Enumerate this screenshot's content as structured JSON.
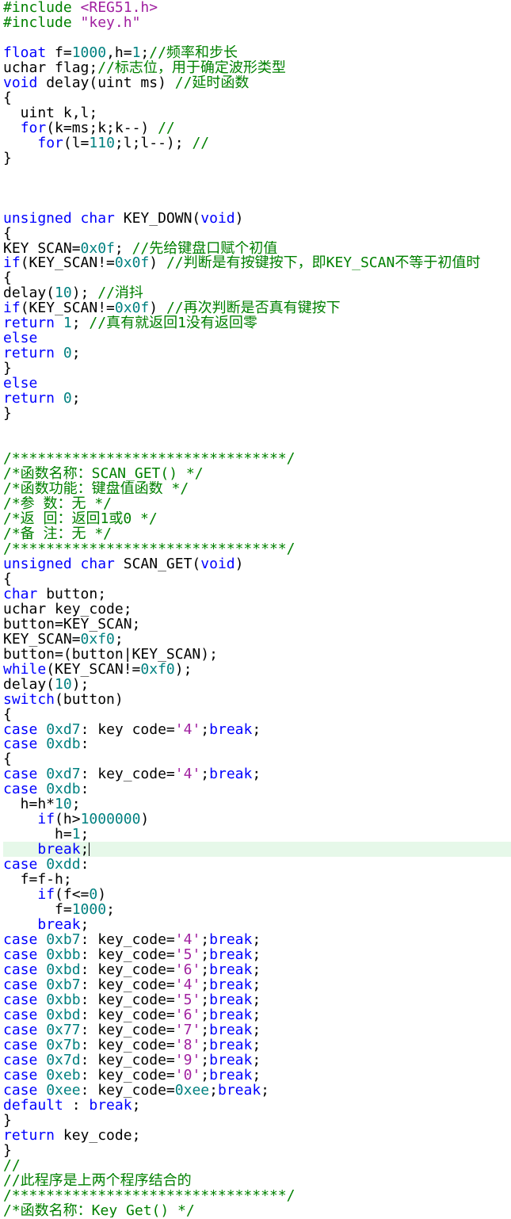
{
  "theme": {
    "background": "#FFFFFF",
    "text": "#000000",
    "keyword": "#0000FF",
    "number": "#008080",
    "string": "#A020A0",
    "char": "#A020A0",
    "comment": "#008000",
    "preproc": "#008000",
    "current_line": "#E6F8E9",
    "cursor": "#000000"
  },
  "editor": {
    "current_line": 57,
    "lines": [
      [
        [
          "preproc",
          "#include"
        ],
        [
          "text",
          " "
        ],
        [
          "string",
          "<REG51.h>"
        ]
      ],
      [
        [
          "preproc",
          "#include"
        ],
        [
          "text",
          " "
        ],
        [
          "string",
          "\"key.h\""
        ]
      ],
      [],
      [
        [
          "keyword",
          "float"
        ],
        [
          "text",
          " f="
        ],
        [
          "number",
          "1000"
        ],
        [
          "text",
          ",h="
        ],
        [
          "number",
          "1"
        ],
        [
          "text",
          ";"
        ],
        [
          "comment",
          "//频率和步长"
        ]
      ],
      [
        [
          "text",
          "uchar flag;"
        ],
        [
          "comment",
          "//标志位，用于确定波形类型"
        ]
      ],
      [
        [
          "keyword",
          "void"
        ],
        [
          "text",
          " delay(uint ms) "
        ],
        [
          "comment",
          "//延时函数"
        ]
      ],
      [
        [
          "text",
          "{"
        ]
      ],
      [
        [
          "text",
          "  uint k,l;"
        ]
      ],
      [
        [
          "text",
          "  "
        ],
        [
          "keyword",
          "for"
        ],
        [
          "text",
          "(k=ms;k;k--) "
        ],
        [
          "comment",
          "//"
        ]
      ],
      [
        [
          "text",
          "    "
        ],
        [
          "keyword",
          "for"
        ],
        [
          "text",
          "(l="
        ],
        [
          "number",
          "110"
        ],
        [
          "text",
          ";l;l--); "
        ],
        [
          "comment",
          "//"
        ]
      ],
      [
        [
          "text",
          "}"
        ]
      ],
      [],
      [],
      [],
      [
        [
          "keyword",
          "unsigned char"
        ],
        [
          "text",
          " KEY_DOWN("
        ],
        [
          "keyword",
          "void"
        ],
        [
          "text",
          ")"
        ]
      ],
      [
        [
          "text",
          "{"
        ]
      ],
      [
        [
          "text",
          "KEY_SCAN="
        ],
        [
          "number",
          "0x0f"
        ],
        [
          "text",
          "; "
        ],
        [
          "comment",
          "//先给键盘口赋个初值"
        ]
      ],
      [
        [
          "keyword",
          "if"
        ],
        [
          "text",
          "(KEY_SCAN!="
        ],
        [
          "number",
          "0x0f"
        ],
        [
          "text",
          ") "
        ],
        [
          "comment",
          "//判断是有按键按下，即KEY_SCAN不等于初值时"
        ]
      ],
      [
        [
          "text",
          "{"
        ]
      ],
      [
        [
          "text",
          "delay("
        ],
        [
          "number",
          "10"
        ],
        [
          "text",
          "); "
        ],
        [
          "comment",
          "//消抖"
        ]
      ],
      [
        [
          "keyword",
          "if"
        ],
        [
          "text",
          "(KEY_SCAN!="
        ],
        [
          "number",
          "0x0f"
        ],
        [
          "text",
          ") "
        ],
        [
          "comment",
          "//再次判断是否真有键按下"
        ]
      ],
      [
        [
          "keyword",
          "return"
        ],
        [
          "text",
          " "
        ],
        [
          "number",
          "1"
        ],
        [
          "text",
          "; "
        ],
        [
          "comment",
          "//真有就返回1没有返回零"
        ]
      ],
      [
        [
          "keyword",
          "else"
        ]
      ],
      [
        [
          "keyword",
          "return"
        ],
        [
          "text",
          " "
        ],
        [
          "number",
          "0"
        ],
        [
          "text",
          ";"
        ]
      ],
      [
        [
          "text",
          "}"
        ]
      ],
      [
        [
          "keyword",
          "else"
        ]
      ],
      [
        [
          "keyword",
          "return"
        ],
        [
          "text",
          " "
        ],
        [
          "number",
          "0"
        ],
        [
          "text",
          ";"
        ]
      ],
      [
        [
          "text",
          "}"
        ]
      ],
      [],
      [],
      [
        [
          "comment",
          "/********************************/"
        ]
      ],
      [
        [
          "comment",
          "/*函数名称：SCAN_GET() */"
        ]
      ],
      [
        [
          "comment",
          "/*函数功能：键盘值函数 */"
        ]
      ],
      [
        [
          "comment",
          "/*参 数：无 */"
        ]
      ],
      [
        [
          "comment",
          "/*返 回：返回1或0 */"
        ]
      ],
      [
        [
          "comment",
          "/*备 注：无 */"
        ]
      ],
      [
        [
          "comment",
          "/********************************/"
        ]
      ],
      [
        [
          "keyword",
          "unsigned char"
        ],
        [
          "text",
          " SCAN_GET("
        ],
        [
          "keyword",
          "void"
        ],
        [
          "text",
          ")"
        ]
      ],
      [
        [
          "text",
          "{"
        ]
      ],
      [
        [
          "keyword",
          "char"
        ],
        [
          "text",
          " button;"
        ]
      ],
      [
        [
          "text",
          "uchar key_code;"
        ]
      ],
      [
        [
          "text",
          "button=KEY_SCAN;"
        ]
      ],
      [
        [
          "text",
          "KEY_SCAN="
        ],
        [
          "number",
          "0xf0"
        ],
        [
          "text",
          ";"
        ]
      ],
      [
        [
          "text",
          "button=(button|KEY_SCAN);"
        ]
      ],
      [
        [
          "keyword",
          "while"
        ],
        [
          "text",
          "(KEY_SCAN!="
        ],
        [
          "number",
          "0xf0"
        ],
        [
          "text",
          ");"
        ]
      ],
      [
        [
          "text",
          "delay("
        ],
        [
          "number",
          "10"
        ],
        [
          "text",
          ");"
        ]
      ],
      [
        [
          "keyword",
          "switch"
        ],
        [
          "text",
          "(button)"
        ]
      ],
      [
        [
          "text",
          "{"
        ]
      ],
      [
        [
          "keyword",
          "case"
        ],
        [
          "text",
          " "
        ],
        [
          "number",
          "0xd7"
        ],
        [
          "text",
          ": key_code="
        ],
        [
          "char",
          "'4'"
        ],
        [
          "text",
          ";"
        ],
        [
          "keyword",
          "break"
        ],
        [
          "text",
          ";"
        ]
      ],
      [
        [
          "keyword",
          "case"
        ],
        [
          "text",
          " "
        ],
        [
          "number",
          "0xdb"
        ],
        [
          "text",
          ":"
        ]
      ],
      [
        [
          "text",
          "{"
        ]
      ],
      [
        [
          "keyword",
          "case"
        ],
        [
          "text",
          " "
        ],
        [
          "number",
          "0xd7"
        ],
        [
          "text",
          ": key_code="
        ],
        [
          "char",
          "'4'"
        ],
        [
          "text",
          ";"
        ],
        [
          "keyword",
          "break"
        ],
        [
          "text",
          ";"
        ]
      ],
      [
        [
          "keyword",
          "case"
        ],
        [
          "text",
          " "
        ],
        [
          "number",
          "0xdb"
        ],
        [
          "text",
          ":"
        ]
      ],
      [
        [
          "text",
          "  h=h*"
        ],
        [
          "number",
          "10"
        ],
        [
          "text",
          ";"
        ]
      ],
      [
        [
          "text",
          "    "
        ],
        [
          "keyword",
          "if"
        ],
        [
          "text",
          "(h>"
        ],
        [
          "number",
          "1000000"
        ],
        [
          "text",
          ")"
        ]
      ],
      [
        [
          "text",
          "      h="
        ],
        [
          "number",
          "1"
        ],
        [
          "text",
          ";"
        ]
      ],
      [
        [
          "text",
          "    "
        ],
        [
          "keyword",
          "break"
        ],
        [
          "text",
          ";"
        ]
      ],
      [
        [
          "keyword",
          "case"
        ],
        [
          "text",
          " "
        ],
        [
          "number",
          "0xdd"
        ],
        [
          "text",
          ":"
        ]
      ],
      [
        [
          "text",
          "  f=f-h;"
        ]
      ],
      [
        [
          "text",
          "    "
        ],
        [
          "keyword",
          "if"
        ],
        [
          "text",
          "(f<="
        ],
        [
          "number",
          "0"
        ],
        [
          "text",
          ")"
        ]
      ],
      [
        [
          "text",
          "      f="
        ],
        [
          "number",
          "1000"
        ],
        [
          "text",
          ";"
        ]
      ],
      [
        [
          "text",
          "    "
        ],
        [
          "keyword",
          "break"
        ],
        [
          "text",
          ";"
        ]
      ],
      [
        [
          "keyword",
          "case"
        ],
        [
          "text",
          " "
        ],
        [
          "number",
          "0xb7"
        ],
        [
          "text",
          ": key_code="
        ],
        [
          "char",
          "'4'"
        ],
        [
          "text",
          ";"
        ],
        [
          "keyword",
          "break"
        ],
        [
          "text",
          ";"
        ]
      ],
      [
        [
          "keyword",
          "case"
        ],
        [
          "text",
          " "
        ],
        [
          "number",
          "0xbb"
        ],
        [
          "text",
          ": key_code="
        ],
        [
          "char",
          "'5'"
        ],
        [
          "text",
          ";"
        ],
        [
          "keyword",
          "break"
        ],
        [
          "text",
          ";"
        ]
      ],
      [
        [
          "keyword",
          "case"
        ],
        [
          "text",
          " "
        ],
        [
          "number",
          "0xbd"
        ],
        [
          "text",
          ": key_code="
        ],
        [
          "char",
          "'6'"
        ],
        [
          "text",
          ";"
        ],
        [
          "keyword",
          "break"
        ],
        [
          "text",
          ";"
        ]
      ],
      [
        [
          "keyword",
          "case"
        ],
        [
          "text",
          " "
        ],
        [
          "number",
          "0xb7"
        ],
        [
          "text",
          ": key_code="
        ],
        [
          "char",
          "'4'"
        ],
        [
          "text",
          ";"
        ],
        [
          "keyword",
          "break"
        ],
        [
          "text",
          ";"
        ]
      ],
      [
        [
          "keyword",
          "case"
        ],
        [
          "text",
          " "
        ],
        [
          "number",
          "0xbb"
        ],
        [
          "text",
          ": key_code="
        ],
        [
          "char",
          "'5'"
        ],
        [
          "text",
          ";"
        ],
        [
          "keyword",
          "break"
        ],
        [
          "text",
          ";"
        ]
      ],
      [
        [
          "keyword",
          "case"
        ],
        [
          "text",
          " "
        ],
        [
          "number",
          "0xbd"
        ],
        [
          "text",
          ": key_code="
        ],
        [
          "char",
          "'6'"
        ],
        [
          "text",
          ";"
        ],
        [
          "keyword",
          "break"
        ],
        [
          "text",
          ";"
        ]
      ],
      [
        [
          "keyword",
          "case"
        ],
        [
          "text",
          " "
        ],
        [
          "number",
          "0x77"
        ],
        [
          "text",
          ": key_code="
        ],
        [
          "char",
          "'7'"
        ],
        [
          "text",
          ";"
        ],
        [
          "keyword",
          "break"
        ],
        [
          "text",
          ";"
        ]
      ],
      [
        [
          "keyword",
          "case"
        ],
        [
          "text",
          " "
        ],
        [
          "number",
          "0x7b"
        ],
        [
          "text",
          ": key_code="
        ],
        [
          "char",
          "'8'"
        ],
        [
          "text",
          ";"
        ],
        [
          "keyword",
          "break"
        ],
        [
          "text",
          ";"
        ]
      ],
      [
        [
          "keyword",
          "case"
        ],
        [
          "text",
          " "
        ],
        [
          "number",
          "0x7d"
        ],
        [
          "text",
          ": key_code="
        ],
        [
          "char",
          "'9'"
        ],
        [
          "text",
          ";"
        ],
        [
          "keyword",
          "break"
        ],
        [
          "text",
          ";"
        ]
      ],
      [
        [
          "keyword",
          "case"
        ],
        [
          "text",
          " "
        ],
        [
          "number",
          "0xeb"
        ],
        [
          "text",
          ": key_code="
        ],
        [
          "char",
          "'0'"
        ],
        [
          "text",
          ";"
        ],
        [
          "keyword",
          "break"
        ],
        [
          "text",
          ";"
        ]
      ],
      [
        [
          "keyword",
          "case"
        ],
        [
          "text",
          " "
        ],
        [
          "number",
          "0xee"
        ],
        [
          "text",
          ": key_code="
        ],
        [
          "number",
          "0xee"
        ],
        [
          "text",
          ";"
        ],
        [
          "keyword",
          "break"
        ],
        [
          "text",
          ";"
        ]
      ],
      [
        [
          "keyword",
          "default"
        ],
        [
          "text",
          " : "
        ],
        [
          "keyword",
          "break"
        ],
        [
          "text",
          ";"
        ]
      ],
      [
        [
          "text",
          "}"
        ]
      ],
      [
        [
          "keyword",
          "return"
        ],
        [
          "text",
          " key_code;"
        ]
      ],
      [
        [
          "text",
          "}"
        ]
      ],
      [
        [
          "comment",
          "//"
        ]
      ],
      [
        [
          "comment",
          "//此程序是上两个程序结合的"
        ]
      ],
      [
        [
          "comment",
          "/********************************/"
        ]
      ],
      [
        [
          "comment",
          "/*函数名称：Key_Get() */"
        ]
      ]
    ]
  }
}
